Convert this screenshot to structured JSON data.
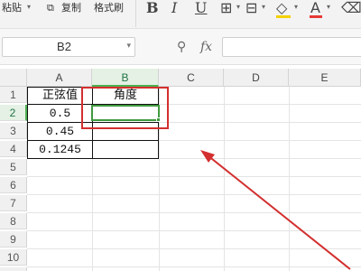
{
  "toolbar": {
    "paste_label": "粘贴",
    "copy_label": "复制",
    "format_painter_label": "格式刷",
    "bold_glyph": "B",
    "italic_glyph": "I",
    "underline_glyph": "U",
    "font_color_glyph": "A"
  },
  "formula_bar": {
    "name_box": "B2",
    "fx_label": "fx",
    "formula": ""
  },
  "sheet": {
    "columns": [
      "A",
      "B",
      "C",
      "D",
      "E"
    ],
    "rows": [
      "1",
      "2",
      "3",
      "4",
      "5",
      "6",
      "7",
      "8",
      "9",
      "10",
      "11"
    ],
    "active_cell": "B2",
    "cells": {
      "A1": "正弦值",
      "B1": "角度",
      "A2": "0.5",
      "A3": "0.45",
      "A4": "0.1245"
    }
  },
  "annotations": {
    "highlight_color": "#d32f2f",
    "selection_color": "#3f9a3f"
  }
}
